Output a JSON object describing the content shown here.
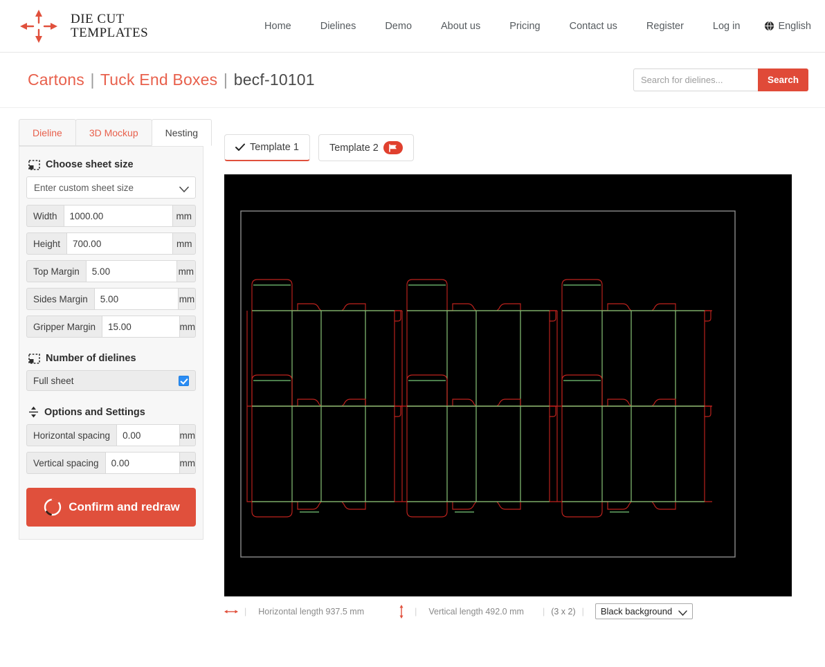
{
  "header": {
    "brand": {
      "line1": "DIE CUT",
      "line2": "TEMPLATES",
      "icon": "four-way-arrow-icon"
    },
    "nav": [
      {
        "label": "Home"
      },
      {
        "label": "Dielines"
      },
      {
        "label": "Demo"
      },
      {
        "label": "About us"
      },
      {
        "label": "Pricing"
      },
      {
        "label": "Contact us"
      },
      {
        "label": "Register"
      },
      {
        "label": "Log in"
      }
    ],
    "language": {
      "label": "English",
      "icon": "globe-icon"
    }
  },
  "subheader": {
    "breadcrumb": {
      "category": "Cartons",
      "subcategory": "Tuck End Boxes",
      "code": "becf-10101",
      "separator": "|"
    },
    "search": {
      "placeholder": "Search for dielines...",
      "value": "",
      "button_label": "Search"
    }
  },
  "view_tabs": [
    {
      "label": "Dieline",
      "active": false
    },
    {
      "label": "3D Mockup",
      "active": false
    },
    {
      "label": "Nesting",
      "active": true
    }
  ],
  "sidebar": {
    "sheet_section": {
      "title": "Choose sheet size",
      "icon": "sheet-size-icon",
      "select_value": "Enter custom sheet size",
      "fields": [
        {
          "label": "Width",
          "value": "1000.00",
          "unit": "mm"
        },
        {
          "label": "Height",
          "value": "700.00",
          "unit": "mm"
        },
        {
          "label": "Top Margin",
          "value": "5.00",
          "unit": "mm"
        },
        {
          "label": "Sides Margin",
          "value": "5.00",
          "unit": "mm"
        },
        {
          "label": "Gripper Margin",
          "value": "15.00",
          "unit": "mm"
        }
      ]
    },
    "dielines_section": {
      "title": "Number of dielines",
      "icon": "sheet-size-icon",
      "full_sheet_label": "Full sheet",
      "full_sheet_checked": true
    },
    "options_section": {
      "title": "Options and Settings",
      "icon": "spacing-icon",
      "fields": [
        {
          "label": "Horizontal spacing",
          "value": "0.00",
          "unit": "mm"
        },
        {
          "label": "Vertical spacing",
          "value": "0.00",
          "unit": "mm"
        }
      ]
    },
    "confirm_button": {
      "label": "Confirm and redraw",
      "icon": "spinner-icon"
    }
  },
  "templates": [
    {
      "label": "Template 1",
      "active": true,
      "icon": "check-icon"
    },
    {
      "label": "Template 2",
      "active": false,
      "badge_icon": "flag-icon"
    }
  ],
  "status_bar": {
    "horizontal_icon": "horizontal-arrow-icon",
    "horizontal_text": "Horizontal length 937.5 mm",
    "vertical_icon": "vertical-arrow-icon",
    "vertical_text": "Vertical length 492.0 mm",
    "separator": "|",
    "count_text": "(3 x 2)",
    "background_select": "Black background"
  },
  "canvas": {
    "background_color": "#000000",
    "cut_line_color": "#c0231e",
    "crease_line_color": "#7ac97a",
    "sheet_border_color": "#8d8d8d",
    "columns": 3,
    "rows": 2,
    "unit_width_mm": 312.5,
    "unit_height_mm": 246.0
  }
}
